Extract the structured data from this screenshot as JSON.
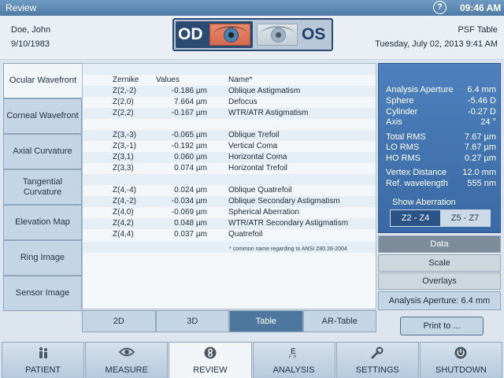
{
  "titlebar": {
    "title": "Review",
    "help_icon": "?",
    "time": "09:46 AM"
  },
  "header": {
    "patient_name": "Doe, John",
    "patient_dob": "9/10/1983",
    "od_label": "OD",
    "os_label": "OS",
    "view_type": "PSF Table",
    "exam_datetime": "Tuesday, July 02, 2013 9:41 AM"
  },
  "left_tabs": [
    {
      "label": "Ocular Wavefront"
    },
    {
      "label": "Corneal Wavefront"
    },
    {
      "label": "Axial Curvature"
    },
    {
      "label": "Tangential Curvature"
    },
    {
      "label": "Elevation Map"
    },
    {
      "label": "Ring Image"
    },
    {
      "label": "Sensor Image"
    }
  ],
  "table": {
    "headers": {
      "zernike": "Zernike",
      "values": "Values",
      "name": "Name*"
    },
    "rows": [
      {
        "z": "Z(2,-2)",
        "v": "-0.186 µm",
        "n": "Oblique Astigmatism"
      },
      {
        "z": "Z(2,0)",
        "v": "7.664 µm",
        "n": "Defocus"
      },
      {
        "z": "Z(2,2)",
        "v": "-0.167 µm",
        "n": "WTR/ATR Astigmatism"
      },
      {
        "z": "Z(3,-3)",
        "v": "-0.065 µm",
        "n": "Oblique Trefoil"
      },
      {
        "z": "Z(3,-1)",
        "v": "-0.192 µm",
        "n": "Vertical Coma"
      },
      {
        "z": "Z(3,1)",
        "v": "0.060 µm",
        "n": "Horizontal Coma"
      },
      {
        "z": "Z(3,3)",
        "v": "0.074 µm",
        "n": "Horizontal Trefoil"
      },
      {
        "z": "Z(4,-4)",
        "v": "0.024 µm",
        "n": "Oblique Quatrefoil"
      },
      {
        "z": "Z(4,-2)",
        "v": "-0.034 µm",
        "n": "Oblique Secondary Astigmatism"
      },
      {
        "z": "Z(4,0)",
        "v": "-0.069 µm",
        "n": "Spherical Aberration"
      },
      {
        "z": "Z(4,2)",
        "v": "0.048 µm",
        "n": "WTR/ATR Secondary Astigmatism"
      },
      {
        "z": "Z(4,4)",
        "v": "0.037 µm",
        "n": "Quatrefoil"
      }
    ],
    "footnote": "* common name regarding to ANSI Z80.28-2004"
  },
  "view_tabs": [
    {
      "label": "2D"
    },
    {
      "label": "3D"
    },
    {
      "label": "Table"
    },
    {
      "label": "AR-Table"
    }
  ],
  "analysis": {
    "rows": [
      {
        "k": "Analysis Aperture",
        "v": "6.4 mm"
      },
      {
        "k": "Sphere",
        "v": "-5.46 D"
      },
      {
        "k": "Cylinder",
        "v": "-0.27 D"
      },
      {
        "k": "Axis",
        "v": "24 °"
      },
      {
        "k": "Total RMS",
        "v": "7.67 µm"
      },
      {
        "k": "LO RMS",
        "v": "7.67 µm"
      },
      {
        "k": "HO RMS",
        "v": "0.27 µm"
      },
      {
        "k": "Vertex Distance",
        "v": "12.0 mm"
      },
      {
        "k": "Ref. wavelength",
        "v": "555 nm"
      }
    ],
    "show_aberration_label": "Show Aberration",
    "aberration_options": [
      {
        "label": "Z2 - Z4"
      },
      {
        "label": "Z5 - Z7"
      }
    ]
  },
  "right_buttons": {
    "data": "Data",
    "scale": "Scale",
    "overlays": "Overlays"
  },
  "aperture_info": "Analysis Aperture: 6.4 mm",
  "print_label": "Print to ...",
  "nav": [
    {
      "label": "PATIENT",
      "icon": "patient-icon"
    },
    {
      "label": "MEASURE",
      "icon": "eye-icon"
    },
    {
      "label": "REVIEW",
      "icon": "review-icon"
    },
    {
      "label": "ANALYSIS",
      "icon": "eye-chart-icon"
    },
    {
      "label": "SETTINGS",
      "icon": "wrench-icon"
    },
    {
      "label": "SHUTDOWN",
      "icon": "power-icon"
    }
  ],
  "colors": {
    "accent": "#4d80bd",
    "active_tab": "#4e77a0",
    "od_highlight": "#2b4b72"
  }
}
